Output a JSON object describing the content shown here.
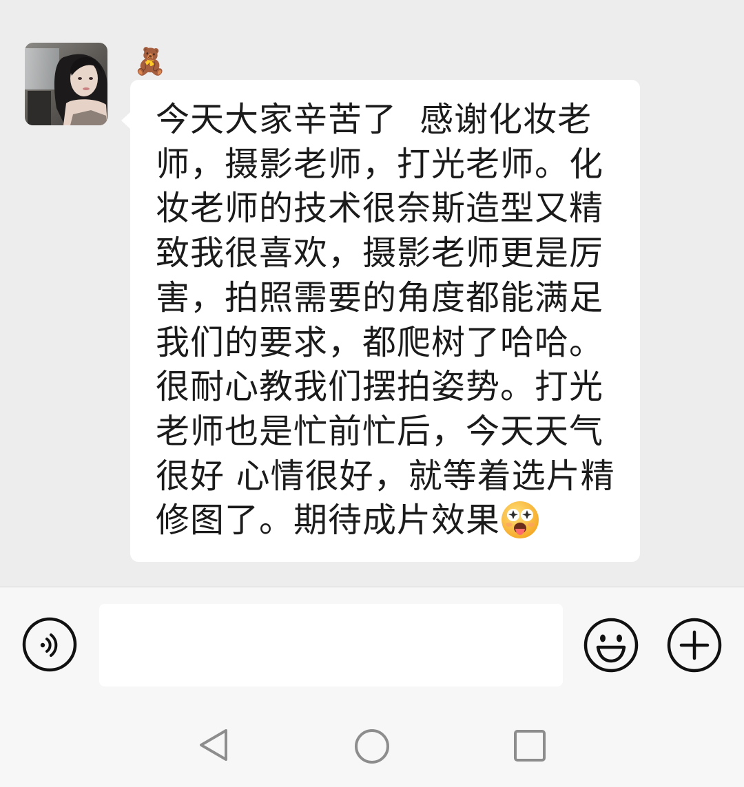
{
  "chat": {
    "sender_name": "🧸",
    "message": {
      "text": "今天大家辛苦了  感谢化妆老师，摄影老师，打光老师。化妆老师的技术很奈斯造型又精致我很喜欢，摄影老师更是厉害，拍照需要的角度都能满足我们的要求，都爬树了哈哈。很耐心教我们摆拍姿势。打光老师也是忙前忙后，今天天气很好 心情很好，就等着选片精修图了。期待成片效果",
      "trailing_emoji": "starstruck-tongue-emoji"
    }
  },
  "input_bar": {
    "voice_icon": "voice-icon",
    "input_value": "",
    "emoji_icon": "smiley-icon",
    "more_icon": "plus-icon"
  },
  "nav_bar": {
    "back_icon": "back-triangle-icon",
    "home_icon": "home-circle-icon",
    "recent_icon": "recent-square-icon"
  },
  "colors": {
    "chat_background": "#ededed",
    "bubble_background": "#ffffff",
    "input_bar_background": "#f7f7f7",
    "text": "#1b1b1b"
  }
}
